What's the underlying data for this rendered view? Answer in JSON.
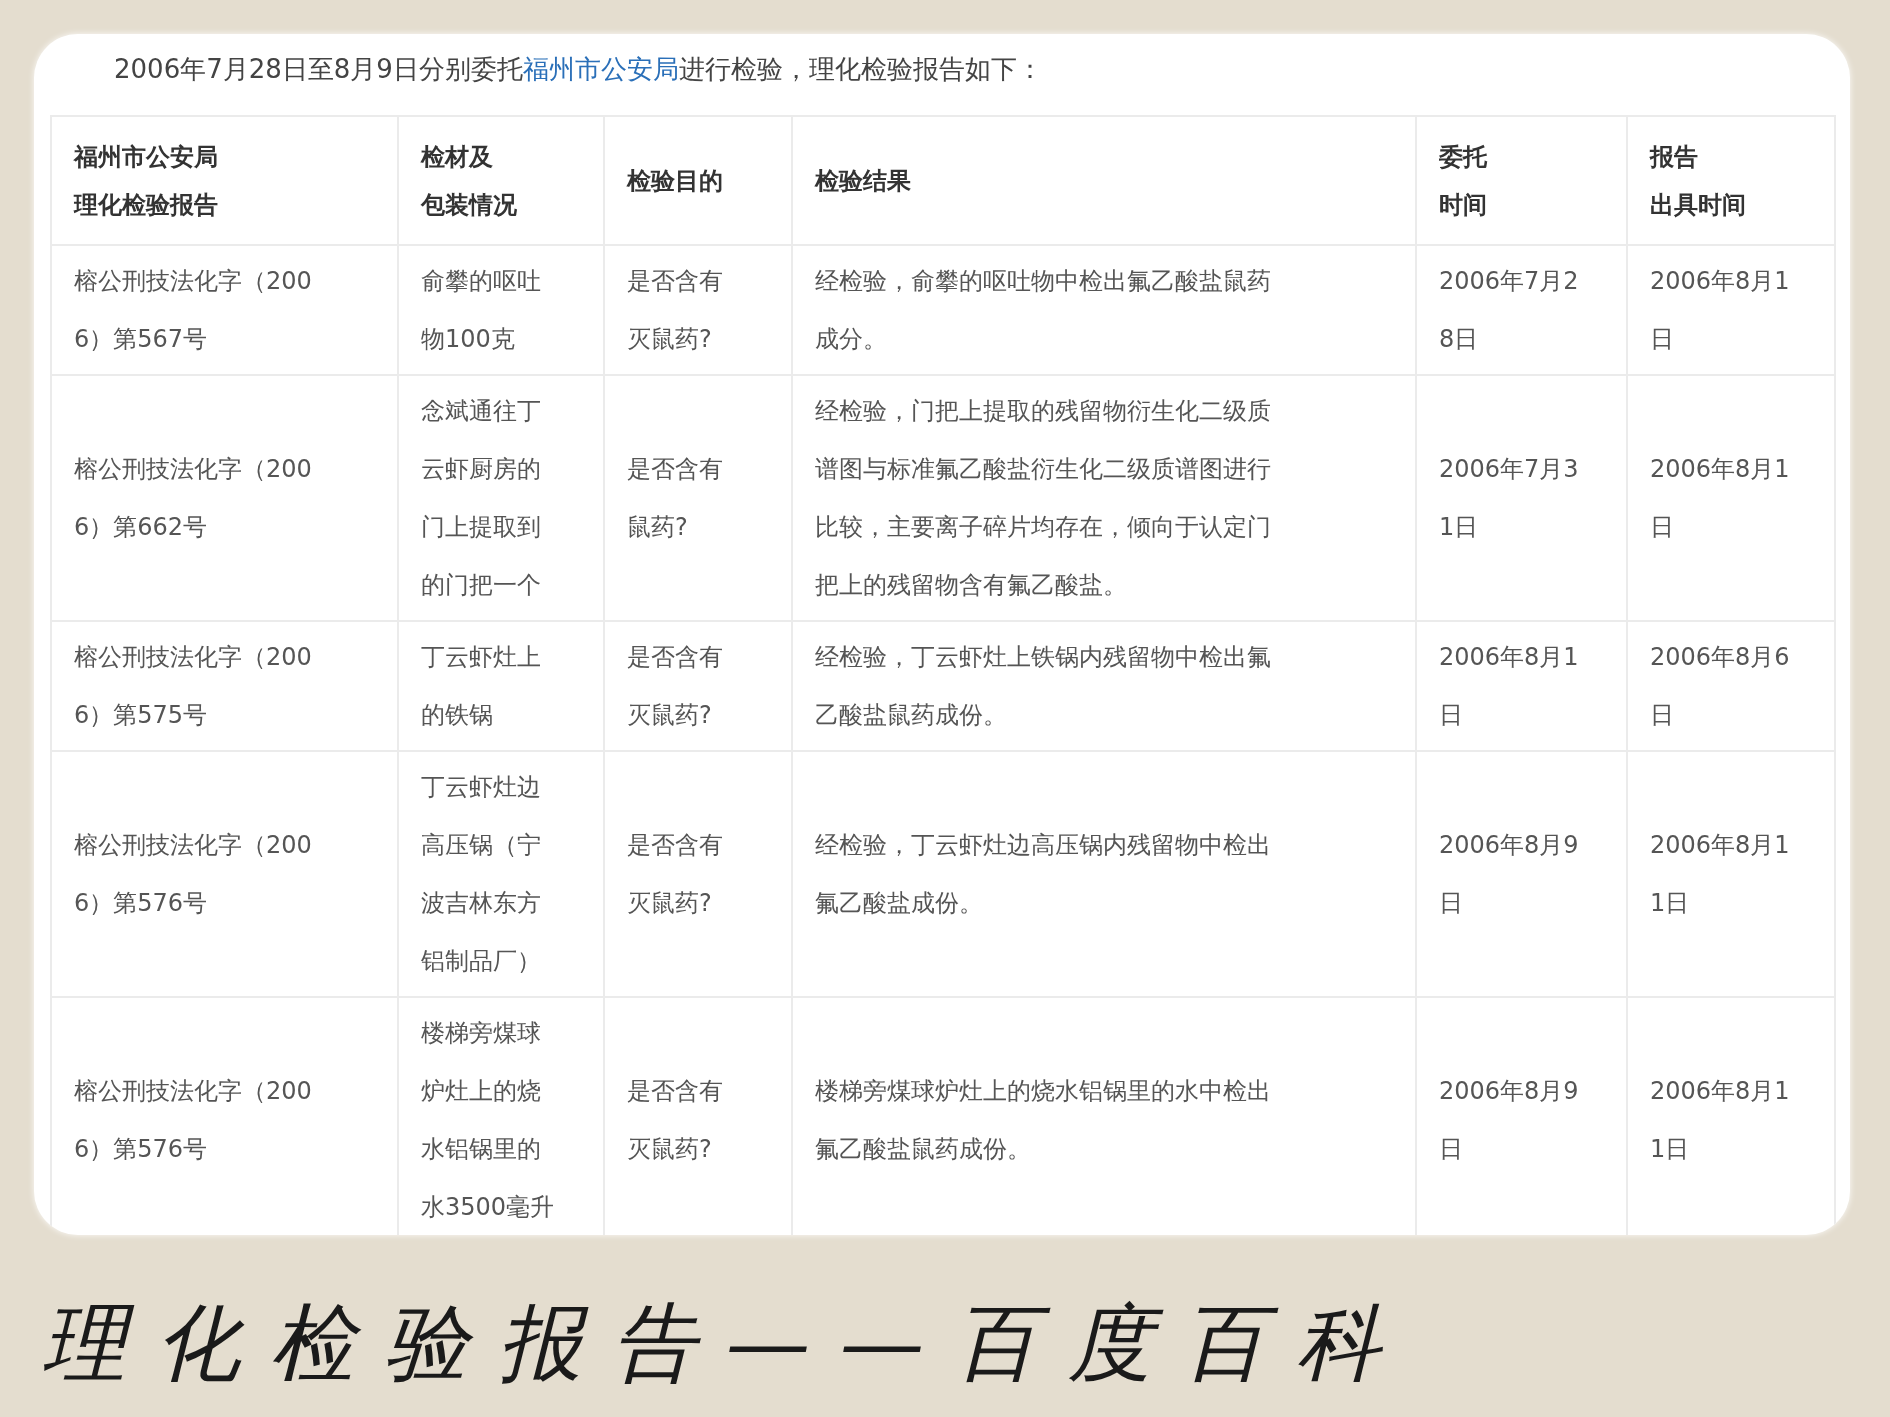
{
  "intro": {
    "before": "2006年7月28日至8月9日分别委托",
    "link": "福州市公安局",
    "after": "进行检验，理化检验报告如下："
  },
  "table": {
    "columns": [
      {
        "lines": [
          "福州市公安局",
          "理化检验报告"
        ]
      },
      {
        "lines": [
          "检材及",
          "包装情况"
        ]
      },
      {
        "lines": [
          "检验目的"
        ]
      },
      {
        "lines": [
          "检验结果"
        ]
      },
      {
        "lines": [
          "委托",
          "时间"
        ]
      },
      {
        "lines": [
          "报告",
          "出具时间"
        ]
      }
    ],
    "rows": [
      [
        [
          "榕公刑技法化字（200",
          "6）第567号"
        ],
        [
          "俞攀的呕吐",
          "物100克"
        ],
        [
          "是否含有",
          "灭鼠药?"
        ],
        [
          "经检验，俞攀的呕吐物中检出氟乙酸盐鼠药",
          "成分。"
        ],
        [
          "2006年7月2",
          "8日"
        ],
        [
          "2006年8月1",
          "日"
        ]
      ],
      [
        [
          "榕公刑技法化字（200",
          "6）第662号"
        ],
        [
          "念斌通往丁",
          "云虾厨房的",
          "门上提取到",
          "的门把一个"
        ],
        [
          "是否含有",
          "鼠药?"
        ],
        [
          "经检验，门把上提取的残留物衍生化二级质",
          "谱图与标准氟乙酸盐衍生化二级质谱图进行",
          "比较，主要离子碎片均存在，倾向于认定门",
          "把上的残留物含有氟乙酸盐。"
        ],
        [
          "2006年7月3",
          "1日"
        ],
        [
          "2006年8月1",
          "日"
        ]
      ],
      [
        [
          "榕公刑技法化字（200",
          "6）第575号"
        ],
        [
          "丁云虾灶上",
          "的铁锅"
        ],
        [
          "是否含有",
          "灭鼠药?"
        ],
        [
          "经检验，丁云虾灶上铁锅内残留物中检出氟",
          "乙酸盐鼠药成份。"
        ],
        [
          "2006年8月1",
          "日"
        ],
        [
          "2006年8月6",
          "日"
        ]
      ],
      [
        [
          "榕公刑技法化字（200",
          "6）第576号"
        ],
        [
          "丁云虾灶边",
          "高压锅（宁",
          "波吉林东方",
          "铝制品厂）"
        ],
        [
          "是否含有",
          "灭鼠药?"
        ],
        [
          "经检验，丁云虾灶边高压锅内残留物中检出",
          "氟乙酸盐成份。"
        ],
        [
          "2006年8月9",
          "日"
        ],
        [
          "2006年8月1",
          "1日"
        ]
      ],
      [
        [
          "榕公刑技法化字（200",
          "6）第576号"
        ],
        [
          "楼梯旁煤球",
          "炉灶上的烧",
          "水铝锅里的",
          "水3500毫升"
        ],
        [
          "是否含有",
          "灭鼠药?"
        ],
        [
          "楼梯旁煤球炉灶上的烧水铝锅里的水中检出",
          "氟乙酸盐鼠药成份。"
        ],
        [
          "2006年8月9",
          "日"
        ],
        [
          "2006年8月1",
          "1日"
        ]
      ]
    ]
  },
  "caption": "理化检验报告——百度百科"
}
